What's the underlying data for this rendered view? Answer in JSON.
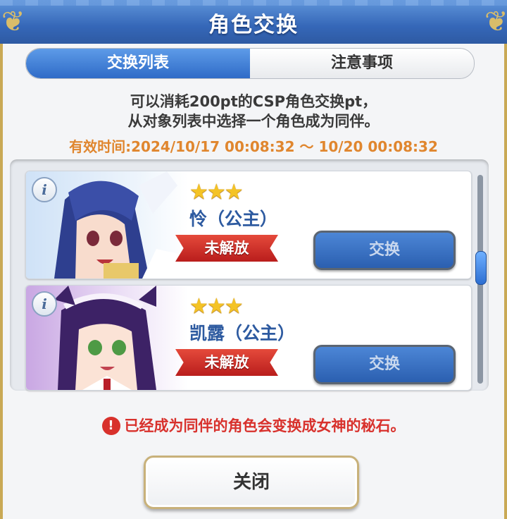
{
  "header": {
    "title": "角色交换"
  },
  "tabs": [
    {
      "label": "交换列表",
      "active": true
    },
    {
      "label": "注意事项",
      "active": false
    }
  ],
  "description": {
    "line1": "可以消耗200pt的CSP角色交换pt，",
    "line2": "从对象列表中选择一个角色成为同伴。"
  },
  "period": "有效时间:2024/10/17 00:08:32 ～ 10/20 00:08:32",
  "characters": [
    {
      "stars": "★★★",
      "name": "怜（公主）",
      "status": "未解放",
      "button": "交换",
      "info": "i"
    },
    {
      "stars": "★★★",
      "name": "凯露（公主）",
      "status": "未解放",
      "button": "交换",
      "info": "i"
    }
  ],
  "warning": {
    "icon": "!",
    "text": "已经成为同伴的角色会变换成女神的秘石。"
  },
  "close_label": "关闭",
  "colors": {
    "accent_blue": "#3567b8",
    "gold_border": "#c9a955",
    "warning_red": "#d8312c",
    "period_orange": "#e0862e"
  }
}
